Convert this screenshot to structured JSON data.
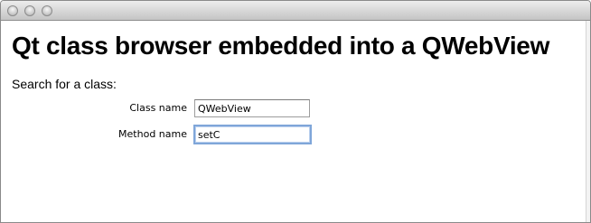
{
  "window": {
    "title": "",
    "buttons": [
      "close",
      "minimize",
      "zoom"
    ]
  },
  "page": {
    "heading": "Qt class browser embedded into a QWebView",
    "search_prompt": "Search for a class:"
  },
  "form": {
    "class_name_label": "Class name",
    "class_name_value": "QWebView",
    "method_name_label": "Method name",
    "method_name_value": "setC"
  }
}
